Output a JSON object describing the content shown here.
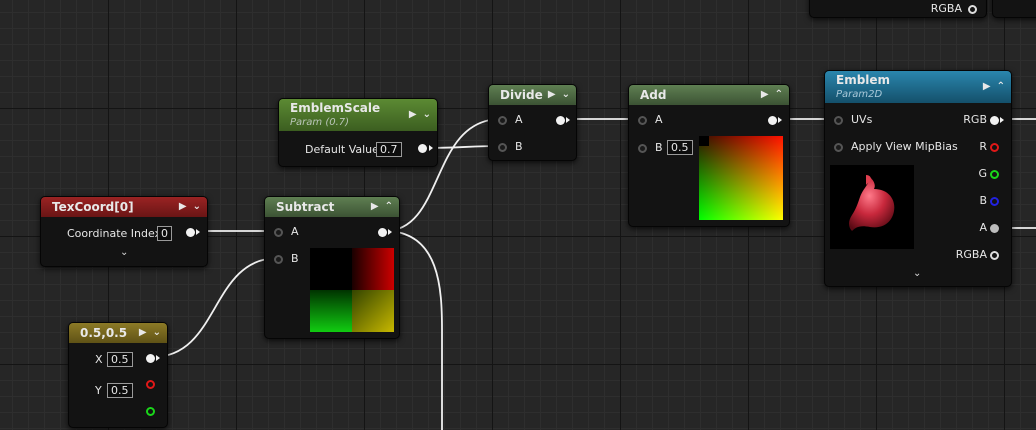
{
  "nodes": {
    "texcoord": {
      "title": "TexCoord[0]",
      "pin_label": "Coordinate Index",
      "value": "0"
    },
    "emblemscale": {
      "title": "EmblemScale",
      "subtitle": "Param (0.7)",
      "pin_label": "Default Value",
      "value": "0.7"
    },
    "const2": {
      "title": "0.5,0.5",
      "x_label": "X",
      "x_value": "0.5",
      "y_label": "Y",
      "y_value": "0.5"
    },
    "subtract": {
      "title": "Subtract",
      "a_label": "A",
      "b_label": "B"
    },
    "divide": {
      "title": "Divide",
      "a_label": "A",
      "b_label": "B"
    },
    "add": {
      "title": "Add",
      "a_label": "A",
      "b_label": "B",
      "b_value": "0.5"
    },
    "emblem": {
      "title": "Emblem",
      "subtitle": "Param2D",
      "uvs_label": "UVs",
      "mipbias_label": "Apply View MipBias",
      "rgb": "RGB",
      "r": "R",
      "g": "G",
      "b": "B",
      "a": "A",
      "rgba": "RGBA"
    },
    "top_partial": {
      "rgba": "RGBA"
    }
  },
  "icons": {
    "play": "▶",
    "chevron_down": "⌄",
    "chevron_up": "⌃"
  },
  "colors": {
    "texcoord_header": "#8a1c1c",
    "scalar_header": "#4f7a2e",
    "vector_header": "#7a6a20",
    "math_header": "#4e6b44",
    "texture_header": "#1f6e8e",
    "wire": "#f2f2f2"
  }
}
